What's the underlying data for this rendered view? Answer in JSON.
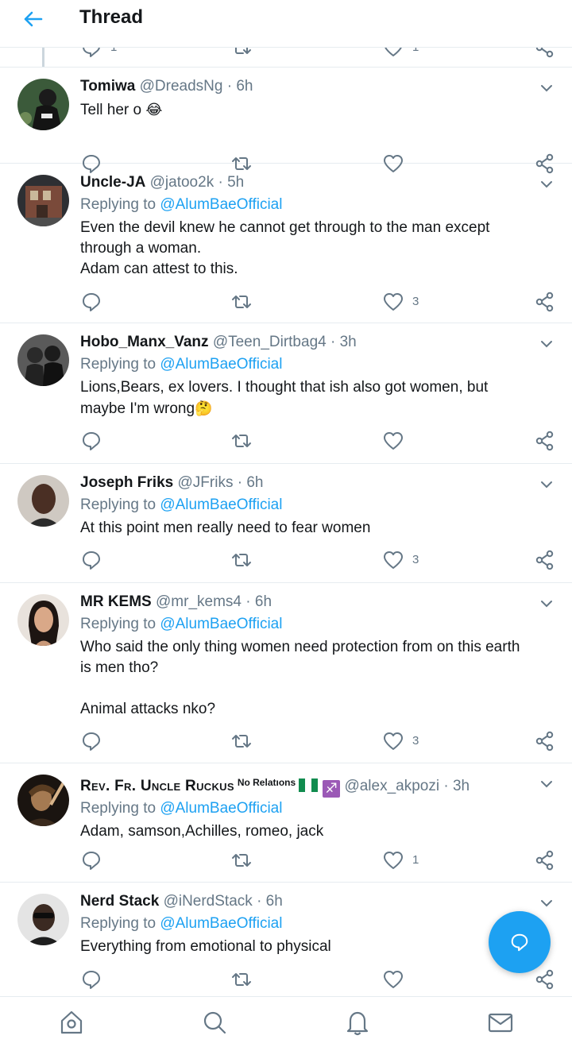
{
  "header": {
    "title": "Thread"
  },
  "partial": {
    "reply_count": "1",
    "like_count": "1"
  },
  "tweets": [
    {
      "name": "Tomiwa",
      "handle": "@DreadsNg",
      "time": "6h",
      "replying": false,
      "text": "Tell her o",
      "emoji": "😂",
      "likes": ""
    },
    {
      "name": "Uncle-JA",
      "handle": "@jatoo2k",
      "time": "5h",
      "replying": true,
      "text": "Even the devil knew he cannot get through to the man except\nthrough a woman.\nAdam can attest to this.",
      "likes": "3"
    },
    {
      "name": "Hobo_Manx_Vanz",
      "handle": "@Teen_Dirtbag4",
      "time": "3h",
      "replying": true,
      "text": "Lions,Bears, ex lovers. I thought that ish also got women, but\nmaybe I'm wrong",
      "emoji": "🤔",
      "likes": ""
    },
    {
      "name": "Joseph Friks",
      "handle": "@JFriks",
      "time": "6h",
      "replying": true,
      "text": "At this point men really need to fear women",
      "likes": "3"
    },
    {
      "name": "MR KEMS",
      "handle": "@mr_kems4",
      "time": "6h",
      "replying": true,
      "text": "Who said the only thing women need protection from on this earth\nis men tho?\n\nAnimal attacks nko?",
      "likes": "3"
    },
    {
      "name": "Rev. Fr. Uncle Ruckus",
      "name_suffix": "No Relatıons",
      "flag_icon": "nigeria-flag-icon",
      "zodiac": "♐",
      "handle": "@alex_akpozi",
      "time": "3h",
      "replying": true,
      "text": "Adam, samson,Achilles, romeo, jack",
      "likes": "1"
    },
    {
      "name": "Nerd Stack",
      "handle": "@iNerdStack",
      "time": "6h",
      "replying": true,
      "text": "Everything from emotional to physical",
      "likes": ""
    }
  ],
  "replying_prefix": "Replying to",
  "replying_to": "@AlumBaeOfficial",
  "dot": "·",
  "colors": {
    "accent": "#1da1f2",
    "secondary_text": "#657786",
    "divider": "#e6ecf0"
  },
  "bottom_nav": [
    "home-icon",
    "search-icon",
    "notifications-icon",
    "messages-icon"
  ]
}
